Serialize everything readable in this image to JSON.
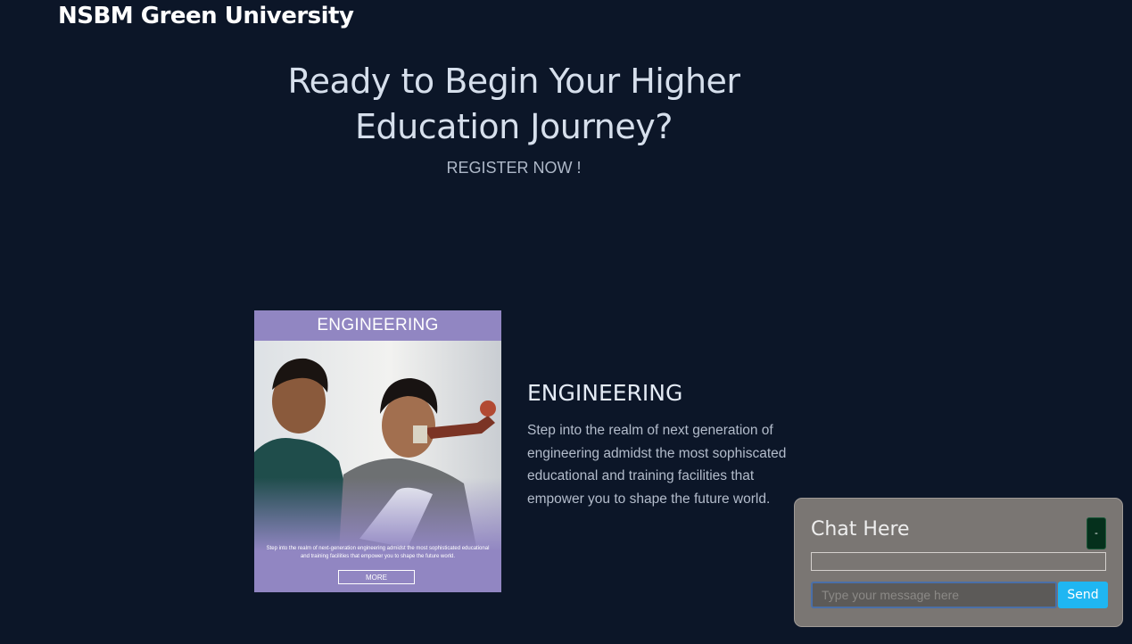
{
  "header": {
    "brand": "NSBM Green University"
  },
  "hero": {
    "title_line1": "Ready to Begin Your Higher",
    "title_line2": "Education Journey?",
    "cta": "REGISTER NOW !"
  },
  "program_card": {
    "image_title": "ENGINEERING",
    "image_caption": "Step into the realm of next-generation engineering admidst the most sophisticated educational and training facilities that empower you to shape the future world.",
    "image_button": "MORE",
    "title": "ENGINEERING",
    "description": "Step into the realm of next generation of engineering admidst the most sophiscated educational and training facilities that empower you to shape the future world."
  },
  "chat": {
    "title": "Chat Here",
    "minimize_label": "-",
    "input_placeholder": "Type your message here",
    "input_value": "",
    "send_label": "Send"
  },
  "colors": {
    "page_background": "#0c1628",
    "card_accent": "#9186c2",
    "chat_background": "#7a7673",
    "send_button": "#1fb6f2",
    "minimize_button": "#05301c"
  },
  "icons": {
    "minimize": "minus-icon"
  }
}
